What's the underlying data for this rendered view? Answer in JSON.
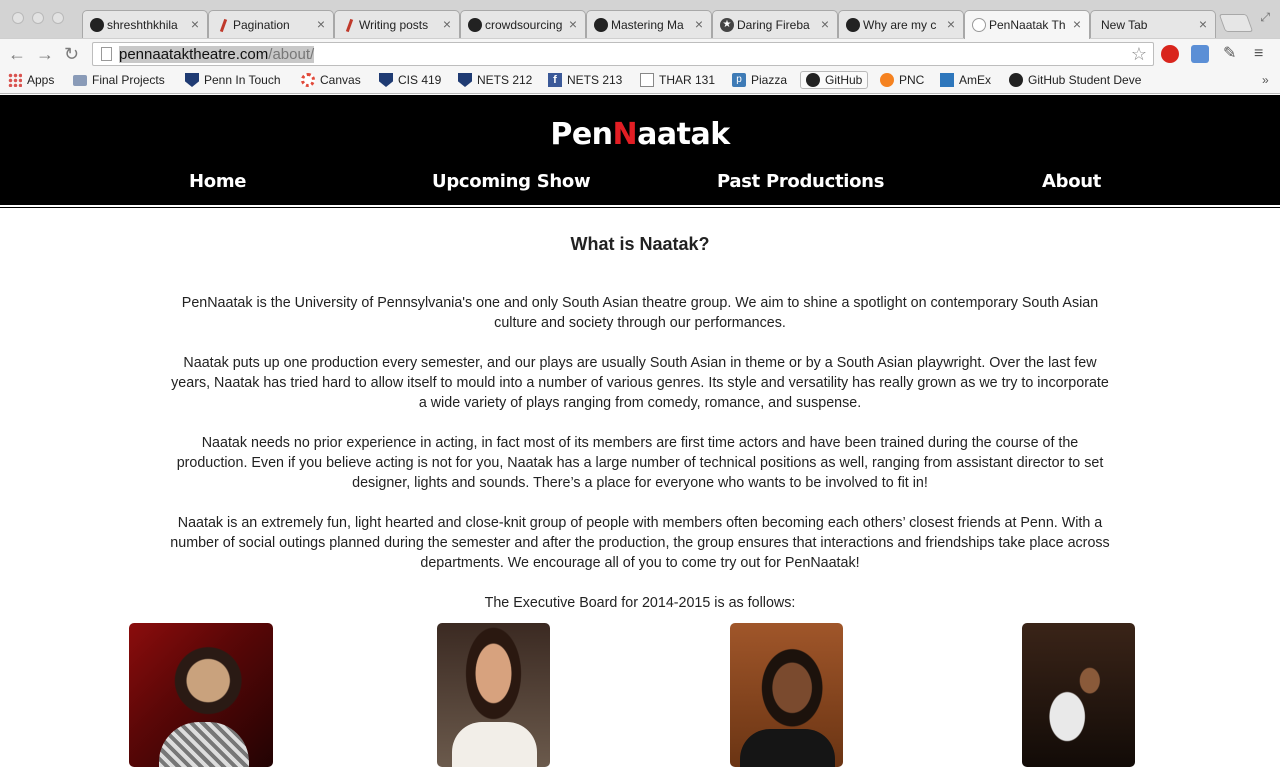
{
  "browser": {
    "tabs": [
      {
        "title": "shreshthkhila",
        "icon": "github-icon",
        "active": false
      },
      {
        "title": "Pagination",
        "icon": "pen-icon",
        "active": false
      },
      {
        "title": "Writing posts",
        "icon": "pen-icon",
        "active": false
      },
      {
        "title": "crowdsourcing",
        "icon": "github-icon",
        "active": false
      },
      {
        "title": "Mastering Ma",
        "icon": "github-icon",
        "active": false
      },
      {
        "title": "Daring Fireba",
        "icon": "star-icon",
        "active": false
      },
      {
        "title": "Why are my c",
        "icon": "github-icon",
        "active": false
      },
      {
        "title": "PenNaatak Th",
        "icon": "pennaatak-icon",
        "active": true
      },
      {
        "title": "New Tab",
        "icon": "",
        "active": false
      }
    ],
    "tab_close": "×",
    "address": {
      "domain": "pennaataktheatre.com",
      "path": "/about/"
    },
    "bookmarks": [
      {
        "label": "Apps",
        "icon": "apps-icon"
      },
      {
        "label": "Final Projects",
        "icon": "folder-icon"
      },
      {
        "label": "Penn In Touch",
        "icon": "penn-shield-icon"
      },
      {
        "label": "Canvas",
        "icon": "canvas-icon"
      },
      {
        "label": "CIS 419",
        "icon": "penn-shield-icon"
      },
      {
        "label": "NETS 212",
        "icon": "penn-shield-icon"
      },
      {
        "label": "NETS 213",
        "icon": "facebook-icon"
      },
      {
        "label": "THAR 131",
        "icon": "document-icon"
      },
      {
        "label": "Piazza",
        "icon": "piazza-icon"
      },
      {
        "label": "GitHub",
        "icon": "github-icon"
      },
      {
        "label": "PNC",
        "icon": "pnc-icon"
      },
      {
        "label": "AmEx",
        "icon": "amex-icon"
      },
      {
        "label": "GitHub Student Deve",
        "icon": "github-icon"
      }
    ]
  },
  "site": {
    "logo_pre": "Pen",
    "logo_accent": "N",
    "logo_post": "aatak",
    "accent_color": "#e31e24",
    "nav": [
      "Home",
      "Upcoming Show",
      "Past Productions",
      "About"
    ]
  },
  "main": {
    "heading": "What is Naatak?",
    "paragraphs": [
      "PenNaatak is the University of Pennsylvania's one and only South Asian theatre group. We aim to shine a spotlight on contemporary South Asian culture and society through our performances.",
      "Naatak puts up one production every semester, and our plays are usually South Asian in theme or by a South Asian playwright. Over the last few years, Naatak has tried hard to allow itself to mould into a number of various genres. Its style and versatility has really grown as we try to incorporate a wide variety of plays ranging from comedy, romance, and suspense.",
      "Naatak needs no prior experience in acting, in fact most of its members are first time actors and have been trained during the course of the production. Even if you believe acting is not for you, Naatak has a large number of technical positions as well, ranging from assistant director to set designer, lights and sounds. There’s a place for everyone who wants to be involved to fit in!",
      "Naatak is an extremely fun, light hearted and close-knit group of people with members often becoming each others’ closest friends at Penn. With a number of social outings planned during the semester and after the production, the group ensures that interactions and friendships take place across departments. We encourage all of you to come try out for PenNaatak!"
    ],
    "board_intro": "The Executive Board for 2014-2015 is as follows:"
  }
}
